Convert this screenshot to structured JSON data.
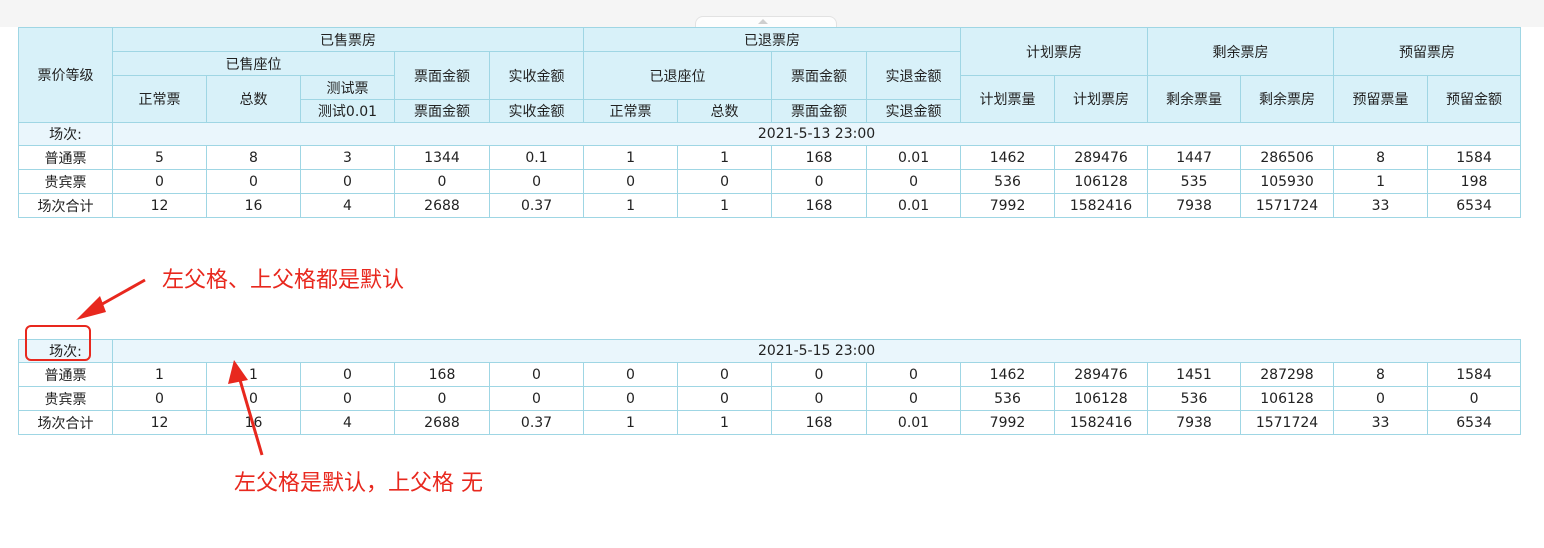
{
  "header": {
    "ticket_level": "票价等级",
    "sold_box": "已售票房",
    "sold_seats": "已售座位",
    "normal": "正常票",
    "total": "总数",
    "test_ticket": "测试票",
    "test_price": "测试0.01",
    "face_amount": "票面金额",
    "actual_received": "实收金额",
    "refund_box": "已退票房",
    "refund_seats": "已退座位",
    "actual_refund": "实退金额",
    "plan_box": "计划票房",
    "plan_qty": "计划票量",
    "remain_box": "剩余票房",
    "remain_qty": "剩余票量",
    "reserve_box": "预留票房",
    "reserve_qty": "预留票量",
    "reserve_amount": "预留金额"
  },
  "section1": {
    "session_label": "场次:",
    "session_value": "2021-5-13 23:00",
    "rows": [
      [
        "普通票",
        "5",
        "8",
        "3",
        "1344",
        "0.1",
        "1",
        "1",
        "168",
        "0.01",
        "1462",
        "289476",
        "1447",
        "286506",
        "8",
        "1584"
      ],
      [
        "贵宾票",
        "0",
        "0",
        "0",
        "0",
        "0",
        "0",
        "0",
        "0",
        "0",
        "536",
        "106128",
        "535",
        "105930",
        "1",
        "198"
      ],
      [
        "场次合计",
        "12",
        "16",
        "4",
        "2688",
        "0.37",
        "1",
        "1",
        "168",
        "0.01",
        "7992",
        "1582416",
        "7938",
        "1571724",
        "33",
        "6534"
      ]
    ]
  },
  "section2": {
    "session_label": "场次:",
    "session_value": "2021-5-15 23:00",
    "rows": [
      [
        "普通票",
        "1",
        "1",
        "0",
        "168",
        "0",
        "0",
        "0",
        "0",
        "0",
        "1462",
        "289476",
        "1451",
        "287298",
        "8",
        "1584"
      ],
      [
        "贵宾票",
        "0",
        "0",
        "0",
        "0",
        "0",
        "0",
        "0",
        "0",
        "0",
        "536",
        "106128",
        "536",
        "106128",
        "0",
        "0"
      ],
      [
        "场次合计",
        "12",
        "16",
        "4",
        "2688",
        "0.37",
        "1",
        "1",
        "168",
        "0.01",
        "7992",
        "1582416",
        "7938",
        "1571724",
        "33",
        "6534"
      ]
    ]
  },
  "annotations": {
    "note1": "左父格、上父格都是默认",
    "note2": "左父格是默认，上父格 无"
  },
  "colors": {
    "header_bg": "#d8f1f9",
    "border": "#9fd6e4",
    "session_bg": "#eaf6fc",
    "annotation": "#e8281e"
  }
}
